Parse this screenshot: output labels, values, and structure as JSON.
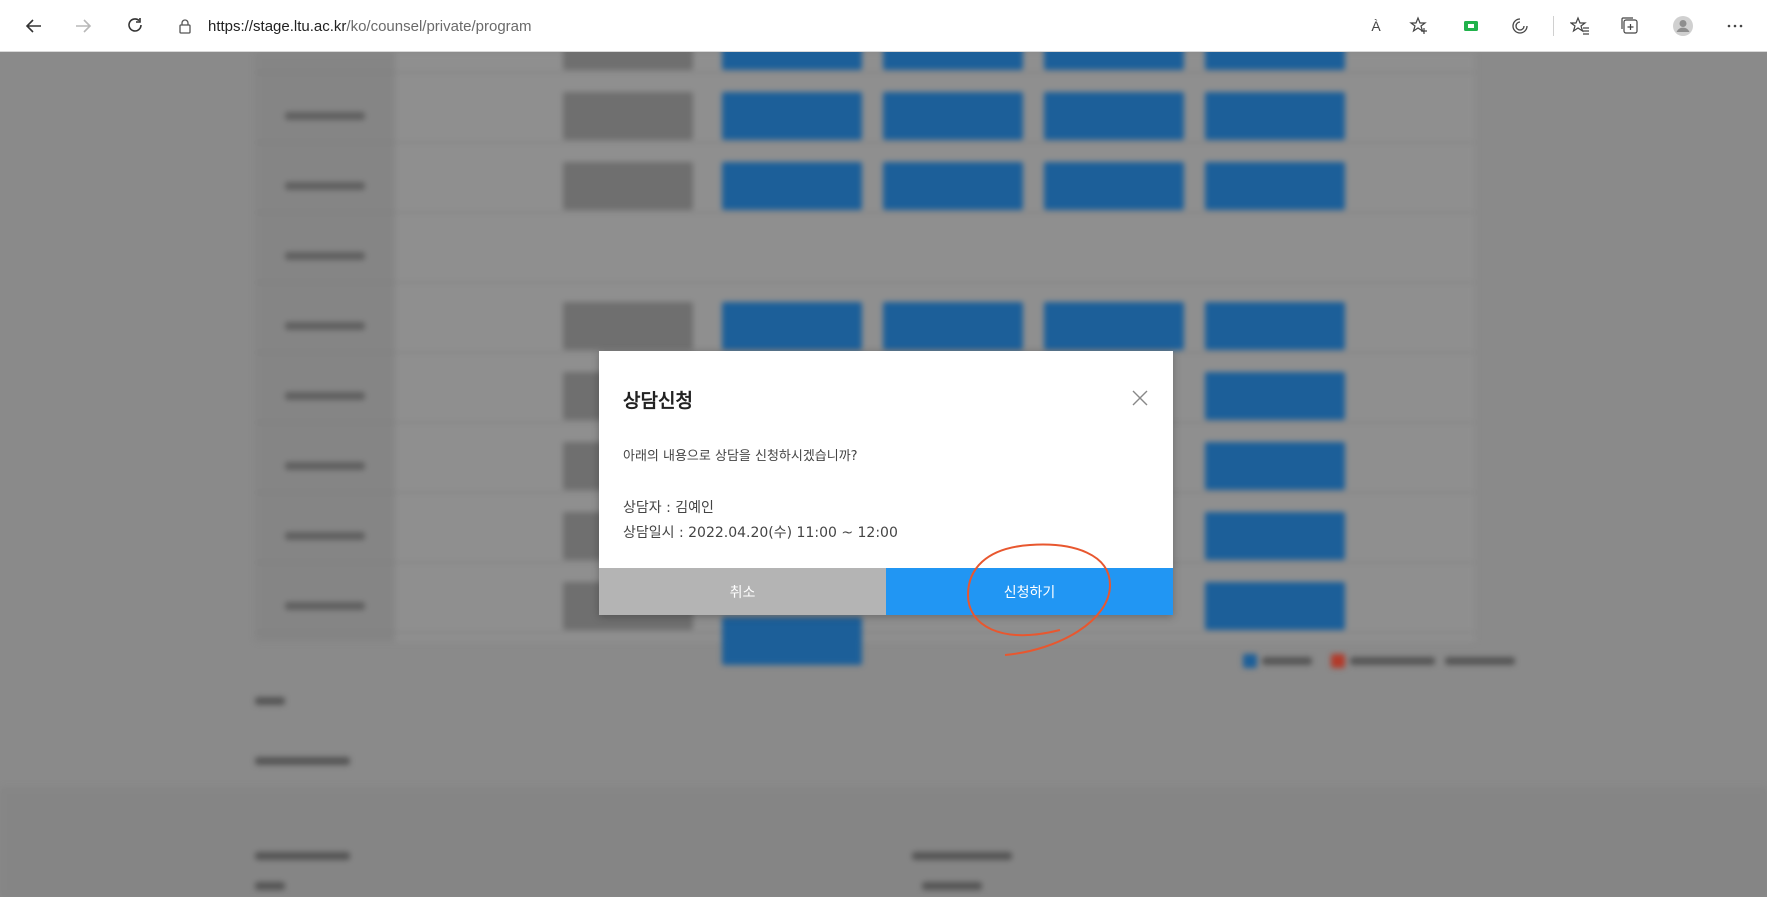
{
  "browser": {
    "url_domain": "https://stage.ltu.ac.kr",
    "url_path": "/ko/counsel/private/program",
    "back_icon": "back-arrow-icon",
    "forward_icon": "forward-arrow-icon",
    "refresh_icon": "refresh-icon",
    "lock_icon": "lock-icon",
    "read_aloud_label": "À",
    "icons": [
      "read-aloud-icon",
      "add-favorite-icon",
      "extension-icon",
      "sync-icon",
      "favorites-icon",
      "collections-icon",
      "profile-icon",
      "more-icon"
    ]
  },
  "modal": {
    "title": "상담신청",
    "message": "아래의 내용으로 상담을 신청하시겠습니까?",
    "counselor": "상담자 : 김예인",
    "datetime": "상담일시 : 2022.04.20(수) 11:00 ~ 12:00",
    "cancel_label": "취소",
    "apply_label": "신청하기"
  },
  "colors": {
    "accent": "#2196f3",
    "cancel": "#b4b4b4",
    "annotation": "#e8572f"
  }
}
